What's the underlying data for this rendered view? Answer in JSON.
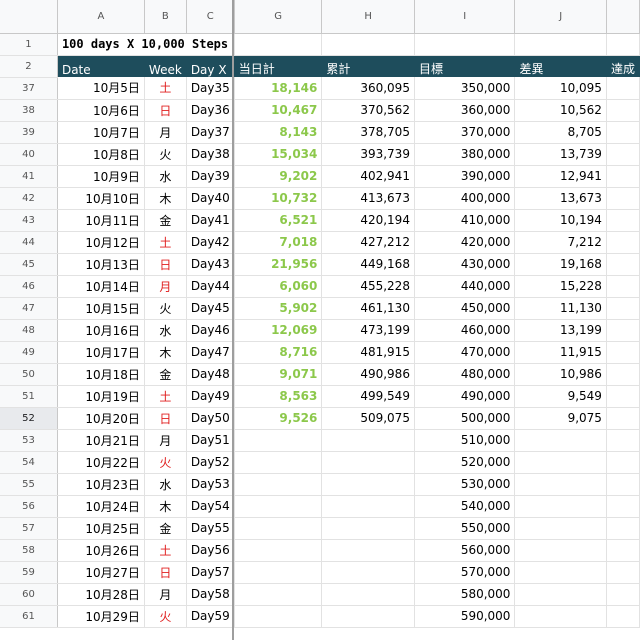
{
  "columns": [
    {
      "key": "A",
      "label": "A"
    },
    {
      "key": "B",
      "label": "B"
    },
    {
      "key": "C",
      "label": "C"
    },
    {
      "key": "G",
      "label": "G"
    },
    {
      "key": "H",
      "label": "H"
    },
    {
      "key": "I",
      "label": "I"
    },
    {
      "key": "J",
      "label": "J"
    }
  ],
  "title_row": {
    "number": "1",
    "text": "100 days X 10,000 Steps"
  },
  "header_row": {
    "number": "2",
    "cells": [
      "Date",
      "Week",
      "Day X",
      "当日計",
      "累計",
      "目標",
      "差異",
      "達成"
    ]
  },
  "active_row": "52",
  "rows": [
    {
      "n": "37",
      "date": "10月5日",
      "week": "土",
      "week_red": true,
      "day": "Day35",
      "steps": "18,146",
      "cum": "360,095",
      "goal": "350,000",
      "diff": "10,095"
    },
    {
      "n": "38",
      "date": "10月6日",
      "week": "日",
      "week_red": true,
      "day": "Day36",
      "steps": "10,467",
      "cum": "370,562",
      "goal": "360,000",
      "diff": "10,562"
    },
    {
      "n": "39",
      "date": "10月7日",
      "week": "月",
      "week_red": false,
      "day": "Day37",
      "steps": "8,143",
      "cum": "378,705",
      "goal": "370,000",
      "diff": "8,705"
    },
    {
      "n": "40",
      "date": "10月8日",
      "week": "火",
      "week_red": false,
      "day": "Day38",
      "steps": "15,034",
      "cum": "393,739",
      "goal": "380,000",
      "diff": "13,739"
    },
    {
      "n": "41",
      "date": "10月9日",
      "week": "水",
      "week_red": false,
      "day": "Day39",
      "steps": "9,202",
      "cum": "402,941",
      "goal": "390,000",
      "diff": "12,941"
    },
    {
      "n": "42",
      "date": "10月10日",
      "week": "木",
      "week_red": false,
      "day": "Day40",
      "steps": "10,732",
      "cum": "413,673",
      "goal": "400,000",
      "diff": "13,673"
    },
    {
      "n": "43",
      "date": "10月11日",
      "week": "金",
      "week_red": false,
      "day": "Day41",
      "steps": "6,521",
      "cum": "420,194",
      "goal": "410,000",
      "diff": "10,194"
    },
    {
      "n": "44",
      "date": "10月12日",
      "week": "土",
      "week_red": true,
      "day": "Day42",
      "steps": "7,018",
      "cum": "427,212",
      "goal": "420,000",
      "diff": "7,212"
    },
    {
      "n": "45",
      "date": "10月13日",
      "week": "日",
      "week_red": true,
      "day": "Day43",
      "steps": "21,956",
      "cum": "449,168",
      "goal": "430,000",
      "diff": "19,168"
    },
    {
      "n": "46",
      "date": "10月14日",
      "week": "月",
      "week_red": true,
      "day": "Day44",
      "steps": "6,060",
      "cum": "455,228",
      "goal": "440,000",
      "diff": "15,228"
    },
    {
      "n": "47",
      "date": "10月15日",
      "week": "火",
      "week_red": false,
      "day": "Day45",
      "steps": "5,902",
      "cum": "461,130",
      "goal": "450,000",
      "diff": "11,130"
    },
    {
      "n": "48",
      "date": "10月16日",
      "week": "水",
      "week_red": false,
      "day": "Day46",
      "steps": "12,069",
      "cum": "473,199",
      "goal": "460,000",
      "diff": "13,199"
    },
    {
      "n": "49",
      "date": "10月17日",
      "week": "木",
      "week_red": false,
      "day": "Day47",
      "steps": "8,716",
      "cum": "481,915",
      "goal": "470,000",
      "diff": "11,915"
    },
    {
      "n": "50",
      "date": "10月18日",
      "week": "金",
      "week_red": false,
      "day": "Day48",
      "steps": "9,071",
      "cum": "490,986",
      "goal": "480,000",
      "diff": "10,986"
    },
    {
      "n": "51",
      "date": "10月19日",
      "week": "土",
      "week_red": true,
      "day": "Day49",
      "steps": "8,563",
      "cum": "499,549",
      "goal": "490,000",
      "diff": "9,549"
    },
    {
      "n": "52",
      "date": "10月20日",
      "week": "日",
      "week_red": true,
      "day": "Day50",
      "steps": "9,526",
      "cum": "509,075",
      "goal": "500,000",
      "diff": "9,075"
    },
    {
      "n": "53",
      "date": "10月21日",
      "week": "月",
      "week_red": false,
      "day": "Day51",
      "steps": "",
      "cum": "",
      "goal": "510,000",
      "diff": ""
    },
    {
      "n": "54",
      "date": "10月22日",
      "week": "火",
      "week_red": true,
      "day": "Day52",
      "steps": "",
      "cum": "",
      "goal": "520,000",
      "diff": ""
    },
    {
      "n": "55",
      "date": "10月23日",
      "week": "水",
      "week_red": false,
      "day": "Day53",
      "steps": "",
      "cum": "",
      "goal": "530,000",
      "diff": ""
    },
    {
      "n": "56",
      "date": "10月24日",
      "week": "木",
      "week_red": false,
      "day": "Day54",
      "steps": "",
      "cum": "",
      "goal": "540,000",
      "diff": ""
    },
    {
      "n": "57",
      "date": "10月25日",
      "week": "金",
      "week_red": false,
      "day": "Day55",
      "steps": "",
      "cum": "",
      "goal": "550,000",
      "diff": ""
    },
    {
      "n": "58",
      "date": "10月26日",
      "week": "土",
      "week_red": true,
      "day": "Day56",
      "steps": "",
      "cum": "",
      "goal": "560,000",
      "diff": ""
    },
    {
      "n": "59",
      "date": "10月27日",
      "week": "日",
      "week_red": true,
      "day": "Day57",
      "steps": "",
      "cum": "",
      "goal": "570,000",
      "diff": ""
    },
    {
      "n": "60",
      "date": "10月28日",
      "week": "月",
      "week_red": false,
      "day": "Day58",
      "steps": "",
      "cum": "",
      "goal": "580,000",
      "diff": ""
    },
    {
      "n": "61",
      "date": "10月29日",
      "week": "火",
      "week_red": true,
      "day": "Day59",
      "steps": "",
      "cum": "",
      "goal": "590,000",
      "diff": ""
    }
  ],
  "colors": {
    "header_bg": "#1e4d5c",
    "steps_green": "#8cc84b",
    "weekend_red": "#e02020"
  }
}
